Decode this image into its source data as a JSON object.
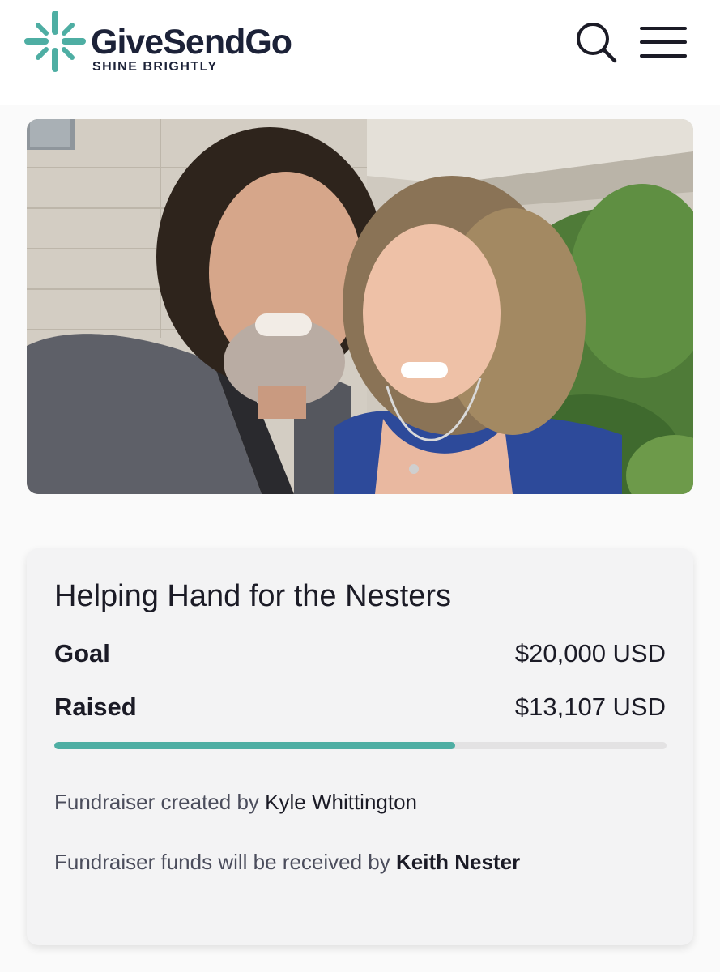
{
  "header": {
    "brand_name": "GiveSendGo",
    "brand_tagline": "SHINE BRIGHTLY",
    "brand_color": "#4eaea3",
    "search_icon": "search-icon",
    "menu_icon": "hamburger-menu-icon"
  },
  "campaign": {
    "title": "Helping Hand for the Nesters",
    "goal_label": "Goal",
    "goal_value": "$20,000 USD",
    "raised_label": "Raised",
    "raised_value": "$13,107 USD",
    "progress_fraction": 0.6554,
    "progress_color": "#4eaea3",
    "created_by_prefix": "Fundraiser created by",
    "created_by_name": "Kyle Whittington",
    "received_by_prefix": "Fundraiser funds will be received by",
    "received_by_name": "Keith Nester"
  }
}
